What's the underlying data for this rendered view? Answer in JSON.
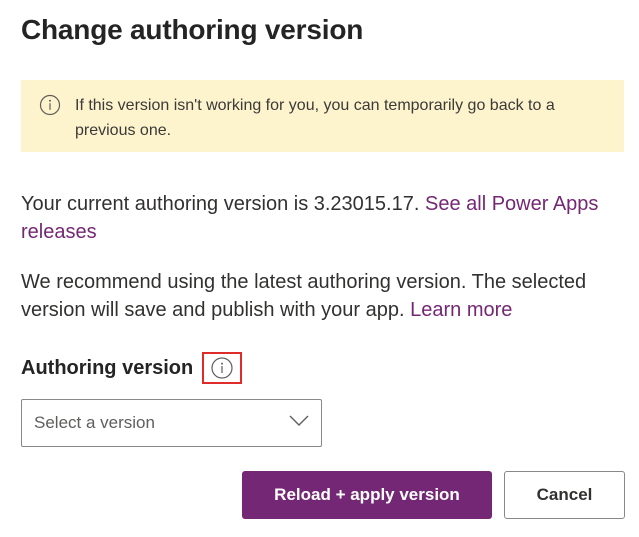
{
  "dialog": {
    "title": "Change authoring version"
  },
  "banner": {
    "icon": "info-icon",
    "text": "If this version isn't working for you, you can temporarily go back to a previous one."
  },
  "current_version": {
    "text": "Your current authoring version is 3.23015.17.",
    "link_text": "See all Power Apps releases"
  },
  "recommendation": {
    "text": "We recommend using the latest authoring version. The selected version will save and publish with your app.",
    "link_text": "Learn more"
  },
  "authoring_version_field": {
    "label": "Authoring version",
    "info_icon": "info-icon",
    "placeholder": "Select a version",
    "dropdown_icon": "chevron-down-icon"
  },
  "actions": {
    "primary_label": "Reload + apply version",
    "secondary_label": "Cancel"
  },
  "colors": {
    "brand": "#742774",
    "banner_bg": "#fdf3cd",
    "highlight_border": "#e02b2b"
  }
}
